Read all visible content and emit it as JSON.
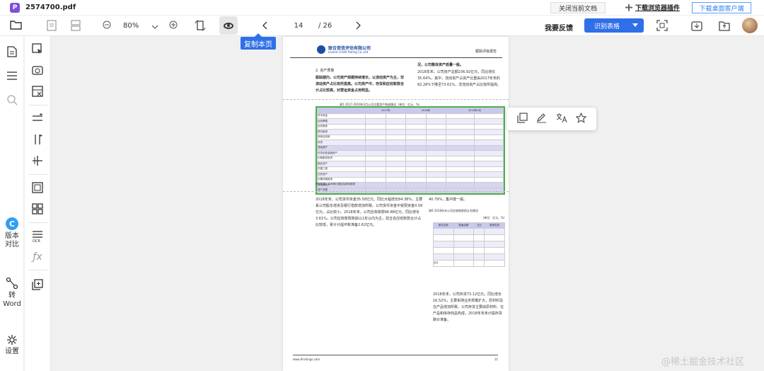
{
  "app": {
    "filename": "2574700.pdf",
    "logo_letter": "P",
    "close_doc_label": "关闭当前文档",
    "plugin_label": "下载浏览器插件",
    "client_label": "下载桌面客户端"
  },
  "toolbar": {
    "zoom": "80%",
    "current_page": "14",
    "total_pages": "/ 26",
    "feedback": "我要反馈",
    "recognize_label": "识别表格"
  },
  "sidebar": {
    "compare_label": "版本\n对比",
    "compare_letter": "C",
    "convert_label": "转\nWord",
    "settings_label": "设置"
  },
  "copy_page_label": "复制本页",
  "document": {
    "company_cn": "联合资信评估有限公司",
    "company_en": "Lianhe Credit Rating Co.,Ltd",
    "header_right": "跟踪评级报告",
    "section_title": "2. 资产质量",
    "section_bold": "跟踪期内，公司资产规模持续增长，以流动资产为主，非流动资产占比有所提高。公司资产中，存货和应收账款合计占比较高，对营运资金占用明显。",
    "right_col_bold": "况，公司整体资产质量一般。",
    "right_col_text": "2018年末，公司资产总额236.92亿元，同比增长35.64%，其中，流动资产占资产比重由2017年末的82.28%下降至73.61%，非流动资产占比有所提高。",
    "table1_title": "表5  2017-2019年3月公司主要资产构成情况（单位：亿元、%）",
    "table1_years": [
      "2017年",
      "2018年",
      "2019年3月"
    ],
    "table1_rows": [
      "货币资金",
      "应收票据",
      "应收账款",
      "预付款项",
      "其他应收款",
      "存货",
      "流动资产",
      "可供出售金融资产",
      "长期股权投资",
      "固定资产",
      "在建工程",
      "无形资产",
      "长期待摊费用",
      "非流动资产",
      "资产总额"
    ],
    "table1_note": "资料来源：公司审计报告及财务报表",
    "left_para": "2018年末，公司货币资金35.58亿元，同比大幅增长84.38%，主要系公司股东增资及银行借款增加所致。公司货币资金中受限资金0.09亿元，占比较小。2018年末，公司应收账款66.88亿元，同比增长3.61%。公司应收账款账龄以1年以内为主，前五名应收账款合计占比较低，累计计提坏账准备2.62亿元。",
    "right_para1": "40.79%，集中度一般。",
    "table2_title": "表6  2018年末公司应收账款前五名情况",
    "table2_unit": "（单位：亿元、%）",
    "table2_headers": [
      "单位名称",
      "账面余额",
      "占比",
      "款项性质"
    ],
    "table2_total": "合计",
    "right_para2": "2018年末，公司存货73.12亿元，同比增长16.52%，主要系随业务规模扩大，原材料及在产品增加所致。公司存货主要由原材料、在产品和库存商品构成，2018年末未计提存货跌价准备。",
    "footer_text": "www.lhratings.com",
    "page_number": "11"
  },
  "watermark": "@稀土掘金技术社区",
  "colors": {
    "accent": "#2f6fe8",
    "table_highlight": "#4caf50",
    "table_header": "#c8c8f0"
  }
}
